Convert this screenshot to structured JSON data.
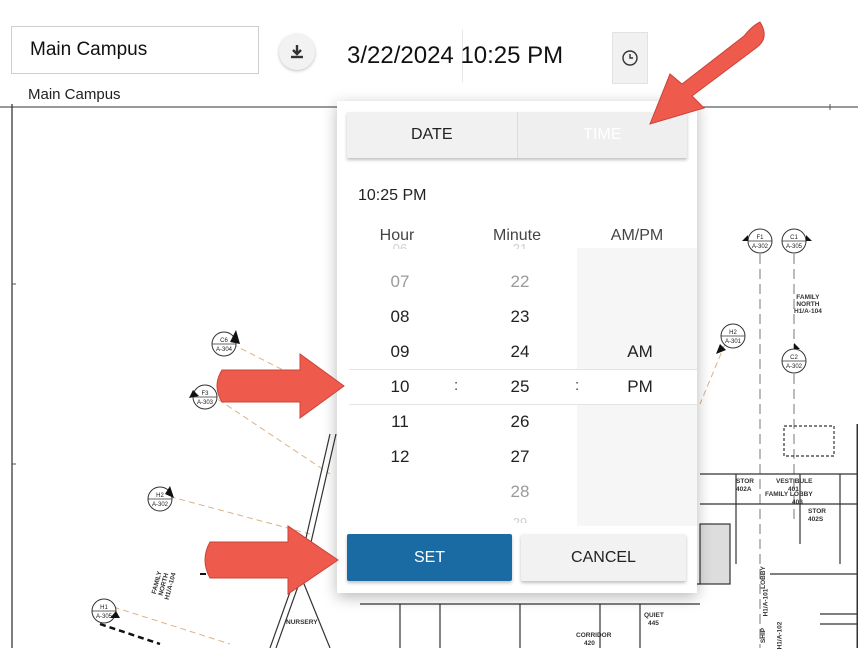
{
  "toolbar": {
    "location_value": "Main Campus",
    "location_caption": "Main Campus",
    "datetime_value": "3/22/2024 10:25 PM",
    "download_icon": "download-icon",
    "clock_icon": "clock-icon"
  },
  "picker": {
    "tabs": {
      "date": "DATE",
      "time": "TIME"
    },
    "current_time": "10:25 PM",
    "columns": {
      "hour": "Hour",
      "minute": "Minute",
      "ampm": "AM/PM"
    },
    "hours": [
      "07",
      "08",
      "09",
      "10",
      "11",
      "12"
    ],
    "minutes": [
      "22",
      "23",
      "24",
      "25",
      "26",
      "27",
      "28"
    ],
    "ampm": [
      "AM",
      "PM"
    ],
    "selected": {
      "hour": "10",
      "minute": "25",
      "ampm": "PM"
    },
    "separator": ":",
    "set_label": "SET",
    "cancel_label": "CANCEL"
  },
  "floorplan": {
    "labels": {
      "family_north_1": "FAMILY\nNORTH\nH1/A-104",
      "family_north_2": "FAMILY\nNORTH\nH1/A-104",
      "family_lobby": "FAMILY LOBBY",
      "family_lobby_num": "403",
      "vestibule": "VESTIBULE",
      "vestibule_num": "401",
      "stor1": "STOR",
      "stor1_num": "402A",
      "stor2": "STOR",
      "stor2_num": "402S",
      "nursery": "NURSERY",
      "quiet": "QUIET",
      "quiet_num": "445",
      "corridor": "CORRIDOR",
      "corridor_num": "420",
      "lobby": "LOBBY",
      "lobby_ref": "H1/A-101",
      "ship": "SHIP",
      "ship_ref": "H1/A-102"
    },
    "callouts": [
      {
        "top": "C6",
        "bottom": "A-304"
      },
      {
        "top": "F3",
        "bottom": "A-303"
      },
      {
        "top": "H2",
        "bottom": "A-302"
      },
      {
        "top": "H2",
        "bottom": "A-301"
      },
      {
        "top": "F1",
        "bottom": "A-302"
      },
      {
        "top": "C1",
        "bottom": "A-305"
      },
      {
        "top": "C2",
        "bottom": "A-302"
      },
      {
        "top": "H1",
        "bottom": "A-305"
      }
    ]
  },
  "colors": {
    "set_button": "#1a6aa3",
    "arrow": "#ee5a4c"
  }
}
